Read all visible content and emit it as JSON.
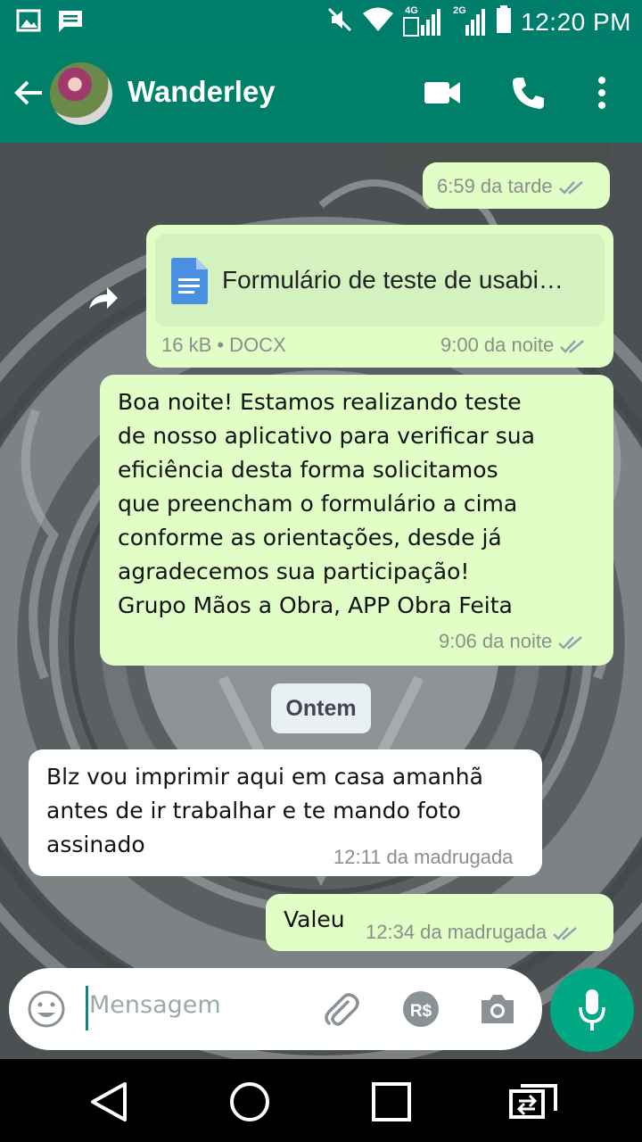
{
  "status_bar": {
    "time": "12:20 PM",
    "network_4g": "4G",
    "network_2g": "2G"
  },
  "header": {
    "contact_name": "Wanderley"
  },
  "messages": [
    {
      "type": "outgoing-partial",
      "time": "6:59 da tarde"
    },
    {
      "type": "document",
      "file_name": "Formulário de teste de usabi…",
      "file_info": "16 kB • DOCX",
      "time": "9:00 da noite"
    },
    {
      "type": "outgoing-text",
      "lines": [
        "Boa noite! Estamos realizando teste",
        "de nosso aplicativo para verificar sua",
        "eficiência desta forma solicitamos",
        "que preencham o formulário a cima",
        "conforme as orientações, desde já",
        "agradecemos sua participação!",
        "Grupo Mãos a Obra, APP Obra Feita"
      ],
      "time": "9:06 da noite"
    },
    {
      "type": "date",
      "label": "Ontem"
    },
    {
      "type": "incoming-text",
      "lines": [
        "Blz vou imprimir aqui em casa amanhã",
        "antes de ir trabalhar e te mando foto",
        "assinado"
      ],
      "time": "12:11 da madrugada"
    },
    {
      "type": "outgoing-text",
      "lines": [
        "Valeu"
      ],
      "time": "12:34 da madrugada"
    }
  ],
  "input": {
    "placeholder": "Mensagem"
  },
  "colors": {
    "header": "#008069",
    "status_bar": "#007e6c",
    "outgoing_bubble": "#e1fec6",
    "incoming_bubble": "#ffffff",
    "mic_button": "#00a884",
    "read_ticks": "#8fa3ad"
  },
  "icons": {
    "header": [
      "back-arrow-icon",
      "video-call-icon",
      "phone-icon",
      "more-vert-icon"
    ],
    "status": [
      "image-icon",
      "message-icon",
      "mute-icon",
      "wifi-icon",
      "signal-icon",
      "battery-icon"
    ],
    "input": [
      "emoji-icon",
      "attach-icon",
      "payment-icon",
      "camera-icon",
      "mic-icon"
    ],
    "nav": [
      "nav-back-icon",
      "nav-home-icon",
      "nav-recents-icon",
      "nav-switch-icon"
    ]
  }
}
